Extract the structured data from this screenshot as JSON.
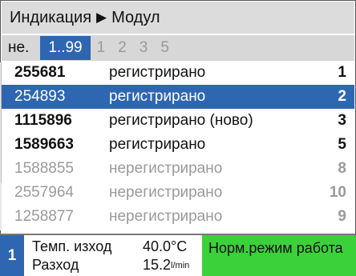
{
  "title": {
    "left": "Индикация",
    "arrow": "▶",
    "right": "Модул"
  },
  "tabs": [
    "не.",
    "1..99",
    "1",
    "2",
    "3",
    "5"
  ],
  "rows": [
    {
      "id": "255681",
      "status": "регистрирано",
      "num": "1"
    },
    {
      "id": "254893",
      "status": "регистрирано",
      "num": "2"
    },
    {
      "id": "1115896",
      "status": "регистрирано (ново)",
      "num": "3"
    },
    {
      "id": "1589663",
      "status": "регистрирано",
      "num": "5"
    },
    {
      "id": "1588855",
      "status": "нерегистрирано",
      "num": "8"
    },
    {
      "id": "2557964",
      "status": "нерегистрирано",
      "num": "10"
    },
    {
      "id": "1258877",
      "status": "нерегистрирано",
      "num": "9"
    }
  ],
  "bottom": {
    "badge": "1",
    "temp_label": "Темп. изход",
    "temp_value": "40.0°C",
    "flow_label": "Разход",
    "flow_value": "15.2",
    "flow_unit": "l/min",
    "status": "Норм.режим работа"
  },
  "colors": {
    "selection": "#2f66b1",
    "status_green": "#3bd13b"
  }
}
